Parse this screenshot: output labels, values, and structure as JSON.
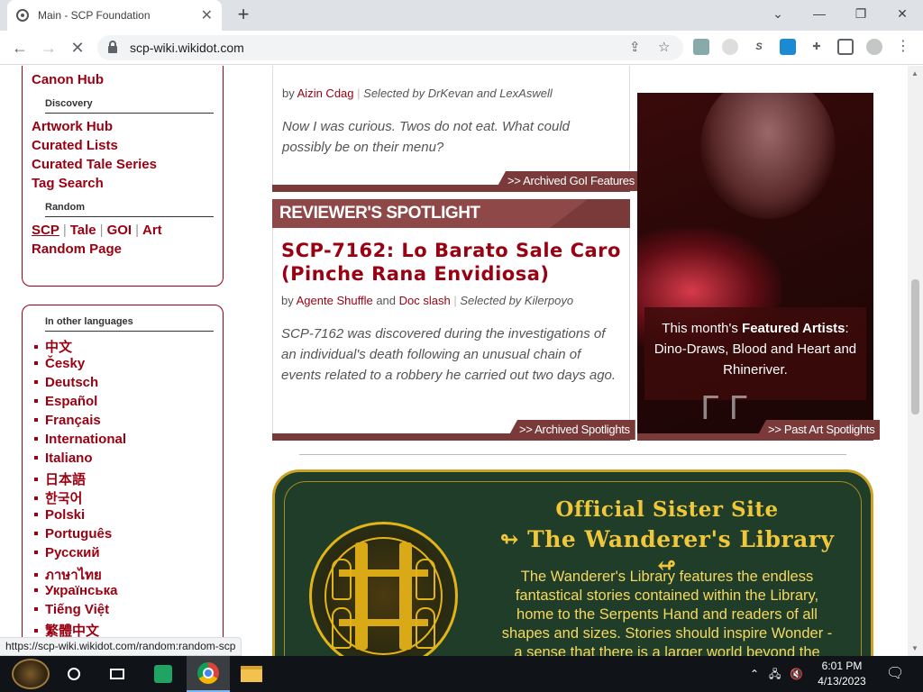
{
  "browser": {
    "tab_title": "Main - SCP Foundation",
    "url": "scp-wiki.wikidot.com",
    "status_url": "https://scp-wiki.wikidot.com/random:random-scp"
  },
  "sidebar": {
    "canon_hub": "Canon Hub",
    "discovery_head": "Discovery",
    "discovery_links": [
      "Artwork Hub",
      "Curated Lists",
      "Curated Tale Series",
      "Tag Search"
    ],
    "random_head": "Random",
    "random_links": [
      "SCP",
      "Tale",
      "GOI",
      "Art"
    ],
    "random_page": "Random Page",
    "languages_head": "In other languages",
    "languages": [
      "中文",
      "Česky",
      "Deutsch",
      "Español",
      "Français",
      "International",
      "Italiano",
      "日本語",
      "한국어",
      "Polski",
      "Português",
      "Русский",
      "ภาษาไทย",
      "Українська",
      "Tiếng Việt",
      "繁體中文"
    ]
  },
  "goi_feature": {
    "byline_prefix": "by",
    "author": "Aizin Cdag",
    "selected": "Selected by DrKevan and LexAswell",
    "quote": "Now I was curious. Twos do not eat. What could possibly be on their menu?",
    "archive": ">> Archived GoI Features"
  },
  "reviewer_spotlight": {
    "banner": "REVIEWER'S SPOTLIGHT",
    "title": "SCP-7162: Lo Barato Sale Caro (Pinche Rana Envidiosa)",
    "by": "by",
    "author1": "Agente Shuffle",
    "and": "and",
    "author2": "Doc slash",
    "selected": "Selected by Kilerpoyo",
    "summary": "SCP-7162 was discovered during the investigations of an individual's death following an unusual chain of events related to a robbery he carried out two days ago.",
    "archive": ">> Archived Spotlights"
  },
  "art_feature": {
    "caption_prefix": "This month's",
    "caption_bold": "Featured Artists",
    "caption_suffix": ": Dino-Draws, Blood and Heart and Rhineriver.",
    "archive": ">> Past Art Spotlights"
  },
  "sister_site": {
    "subtitle": "Official Sister Site",
    "title": "↬ The Wanderer's Library ↫",
    "body": "The Wanderer's Library features the endless fantastical stories contained within the Library, home to the Serpents Hand and readers of all shapes and sizes. Stories should inspire Wonder - a sense that there is a larger world beyond the"
  },
  "taskbar": {
    "time": "6:01 PM",
    "date": "4/13/2023"
  },
  "colors": {
    "brand": "#990011",
    "banner": "#7a3a3a",
    "sister_green": "#1f3d28",
    "sister_gold": "#f0c63a"
  }
}
